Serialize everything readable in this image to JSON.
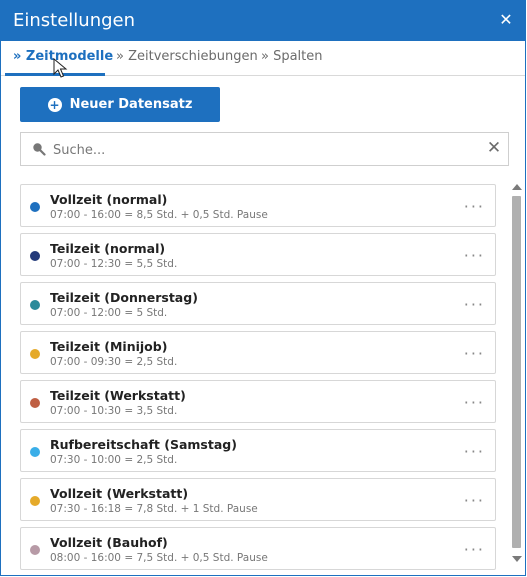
{
  "window": {
    "title": "Einstellungen"
  },
  "tabs": [
    {
      "label": "» Zeitmodelle"
    },
    {
      "label": "» Zeitverschiebungen"
    },
    {
      "label": "» Spalten"
    }
  ],
  "toolbar": {
    "new_label": "Neuer Datensatz"
  },
  "search": {
    "placeholder": "Suche..."
  },
  "items": [
    {
      "title": "Vollzeit (normal)",
      "subtitle": "07:00 - 16:00 = 8,5 Std. + 0,5 Std. Pause",
      "color": "#1e70bf"
    },
    {
      "title": "Teilzeit (normal)",
      "subtitle": "07:00 - 12:30 = 5,5 Std.",
      "color": "#243b7a"
    },
    {
      "title": "Teilzeit (Donnerstag)",
      "subtitle": "07:00 - 12:00 = 5 Std.",
      "color": "#2a8a9a"
    },
    {
      "title": "Teilzeit (Minijob)",
      "subtitle": "07:00 - 09:30 = 2,5 Std.",
      "color": "#e5aa2a"
    },
    {
      "title": "Teilzeit (Werkstatt)",
      "subtitle": "07:00 - 10:30 = 3,5 Std.",
      "color": "#bf5f43"
    },
    {
      "title": "Rufbereitschaft (Samstag)",
      "subtitle": "07:30 - 10:00 = 2,5 Std.",
      "color": "#3aaee8"
    },
    {
      "title": "Vollzeit (Werkstatt)",
      "subtitle": "07:30 - 16:18 = 7,8 Std. + 1 Std. Pause",
      "color": "#e5aa2a"
    },
    {
      "title": "Vollzeit (Bauhof)",
      "subtitle": "08:00 - 16:00 = 7,5 Std. + 0,5 Std. Pause",
      "color": "#b79aa6"
    }
  ],
  "icons": {
    "close": "close-icon",
    "plus": "plus-circle-icon",
    "search": "search-icon",
    "clear": "clear-icon",
    "menu": "more-horizontal-icon"
  }
}
